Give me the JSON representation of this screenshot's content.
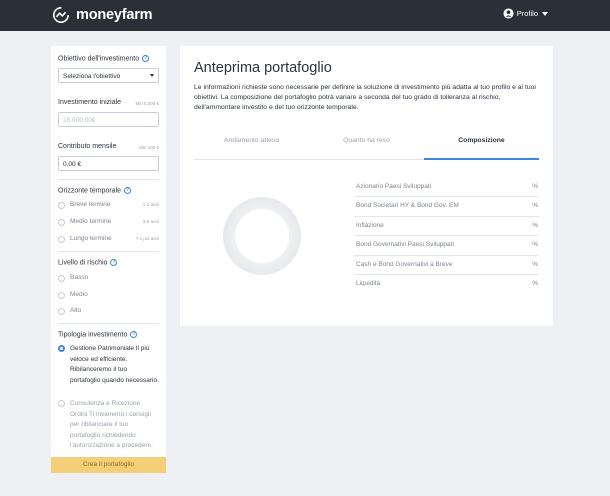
{
  "brand": {
    "name": "moneyfarm"
  },
  "header": {
    "profile_label": "Profilo"
  },
  "sidebar": {
    "goal": {
      "label": "Obiettivo dell'investimento",
      "selected": "Seleziona l'obiettivo"
    },
    "initial": {
      "label": "Investimento iniziale",
      "hint": "Min 5.000 €",
      "placeholder": "15.000,00€"
    },
    "monthly": {
      "label": "Contributo mensile",
      "hint": "Min 100 €",
      "value": "0,00 €"
    },
    "horizon": {
      "label": "Orizzonte temporale",
      "options": [
        {
          "label": "Breve termine",
          "hint": "1-2 anni"
        },
        {
          "label": "Medio termine",
          "hint": "3-6 anni"
        },
        {
          "label": "Lungo termine",
          "hint": "7 o più anni"
        }
      ]
    },
    "risk": {
      "label": "Livello di rischio",
      "options": [
        {
          "label": "Basso"
        },
        {
          "label": "Medio"
        },
        {
          "label": "Alto"
        }
      ]
    },
    "type": {
      "label": "Tipologia investimento",
      "options": [
        {
          "label": "Gestione Patrimoniale Il più veloce ed efficiente. Ribilanceremo il tuo portafoglio quando necessario.",
          "checked": true
        },
        {
          "label": "Consulenza e Ricezione Ordini Ti invieremo i consigli per ribilanciare il tuo portafoglio richiedendo l'autorizzazione a procedere.",
          "checked": false
        }
      ]
    },
    "cta_label": "Crea il portafoglio"
  },
  "main": {
    "title": "Anteprima portafoglio",
    "description": "Le informazioni richieste sono necessarie per definire la soluzione di investimento più adatta al tuo profilo e ai tuoi obiettivi. La composizione del portafoglio potrà variare a seconda del tuo grado di tolleranza al rischio, dell'ammontare investito e del tuo orizzonte temporale.",
    "tabs": [
      {
        "label": "Andamento atteso",
        "active": false
      },
      {
        "label": "Quanto ha reso",
        "active": false
      },
      {
        "label": "Composizione",
        "active": true
      }
    ],
    "composition": [
      {
        "label": "Azionario Paesi Sviluppati",
        "value": "%"
      },
      {
        "label": "Bond Societari HY & Bond Gov. EM",
        "value": "%"
      },
      {
        "label": "Inflazione",
        "value": "%"
      },
      {
        "label": "Bond Governativi Paesi Sviluppati",
        "value": "%"
      },
      {
        "label": "Cash e Bond Governativi a Breve",
        "value": "%"
      },
      {
        "label": "Liquidità",
        "value": "%"
      }
    ]
  },
  "colors": {
    "accent": "#3f87e0",
    "topbar": "#2b3038",
    "cta": "#f4cf78"
  }
}
